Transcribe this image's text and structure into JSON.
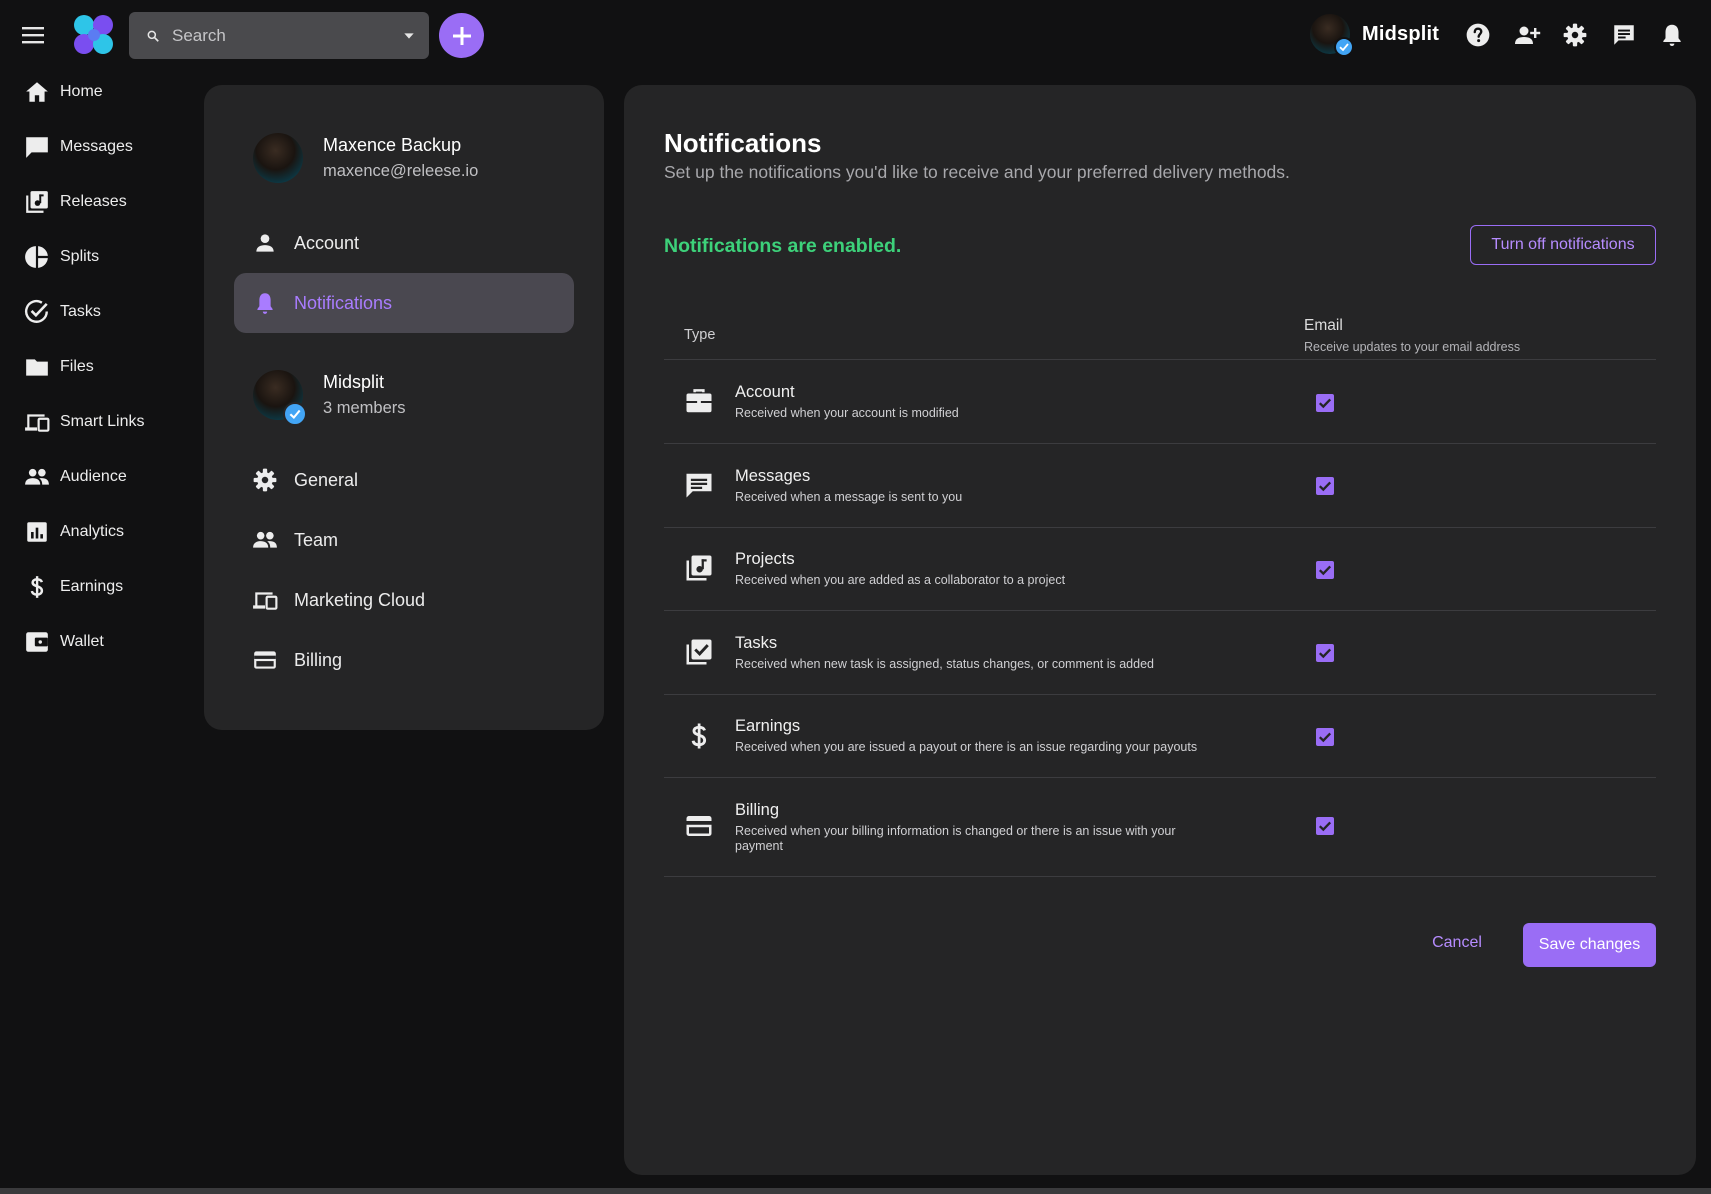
{
  "topbar": {
    "search_placeholder": "Search",
    "org_name": "Midsplit"
  },
  "leftnav": {
    "items": [
      {
        "label": "Home",
        "icon": "home-icon"
      },
      {
        "label": "Messages",
        "icon": "message-icon"
      },
      {
        "label": "Releases",
        "icon": "library-music-icon"
      },
      {
        "label": "Splits",
        "icon": "pie-chart-icon"
      },
      {
        "label": "Tasks",
        "icon": "check-circle-icon"
      },
      {
        "label": "Files",
        "icon": "folder-icon"
      },
      {
        "label": "Smart Links",
        "icon": "devices-icon"
      },
      {
        "label": "Audience",
        "icon": "people-icon"
      },
      {
        "label": "Analytics",
        "icon": "analytics-icon"
      },
      {
        "label": "Earnings",
        "icon": "dollar-icon"
      },
      {
        "label": "Wallet",
        "icon": "wallet-icon"
      }
    ]
  },
  "settings": {
    "user_name": "Maxence Backup",
    "user_email": "maxence@releese.io",
    "user_items": [
      {
        "label": "Account",
        "icon": "person-icon"
      },
      {
        "label": "Notifications",
        "icon": "bell-icon"
      }
    ],
    "org_name": "Midsplit",
    "org_members": "3 members",
    "org_items": [
      {
        "label": "General",
        "icon": "gear-icon"
      },
      {
        "label": "Team",
        "icon": "people-icon"
      },
      {
        "label": "Marketing Cloud",
        "icon": "devices-icon"
      },
      {
        "label": "Billing",
        "icon": "credit-card-icon"
      }
    ]
  },
  "main": {
    "title": "Notifications",
    "subtitle": "Set up the notifications you'd like to receive and your preferred delivery methods.",
    "status": "Notifications are enabled.",
    "turn_off_label": "Turn off notifications",
    "table": {
      "col_type": "Type",
      "col_email": "Email",
      "col_email_sub": "Receive updates to your email address",
      "rows": [
        {
          "title": "Account",
          "desc": "Received when your account is modified",
          "icon": "briefcase-icon",
          "email": true
        },
        {
          "title": "Messages",
          "desc": "Received when a message is sent to you",
          "icon": "message-icon",
          "email": true
        },
        {
          "title": "Projects",
          "desc": "Received when you are added as a collaborator to a project",
          "icon": "library-music-icon",
          "email": true
        },
        {
          "title": "Tasks",
          "desc": "Received when new task is assigned, status changes, or comment is added",
          "icon": "library-check-icon",
          "email": true
        },
        {
          "title": "Earnings",
          "desc": "Received when you are issued a payout or there is an issue regarding your payouts",
          "icon": "dollar-icon",
          "email": true
        },
        {
          "title": "Billing",
          "desc": "Received when your billing information is changed or there is an issue with your payment",
          "icon": "credit-card-icon",
          "email": true
        }
      ]
    },
    "cancel_label": "Cancel",
    "save_label": "Save changes"
  },
  "colors": {
    "accent": "#9a6df5",
    "accent_text": "#b68cff",
    "success": "#3dd17a",
    "panel": "#252526",
    "background": "#111112"
  }
}
